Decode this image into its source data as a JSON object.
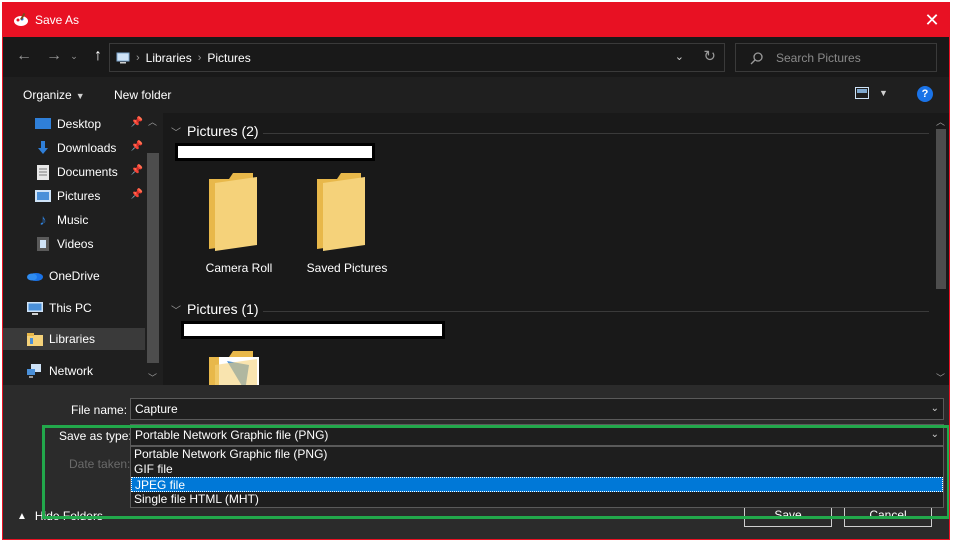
{
  "window": {
    "title": "Save As",
    "close_label": "✕"
  },
  "nav": {
    "back_icon": "arrow-left-icon",
    "forward_icon": "arrow-right-icon",
    "up_icon": "arrow-up-icon",
    "breadcrumbs": [
      "Libraries",
      "Pictures"
    ],
    "search_placeholder": "Search Pictures"
  },
  "commands": {
    "organize": "Organize",
    "new_folder": "New folder",
    "help": "?"
  },
  "sidebar": {
    "items": [
      {
        "label": "Desktop",
        "icon": "desktop-icon",
        "pinned": true
      },
      {
        "label": "Downloads",
        "icon": "download-icon",
        "pinned": true
      },
      {
        "label": "Documents",
        "icon": "document-icon",
        "pinned": true
      },
      {
        "label": "Pictures",
        "icon": "pictures-icon",
        "pinned": true
      },
      {
        "label": "Music",
        "icon": "music-icon",
        "pinned": false
      },
      {
        "label": "Videos",
        "icon": "video-icon",
        "pinned": false
      },
      {
        "label": "OneDrive",
        "icon": "cloud-icon",
        "pinned": false
      },
      {
        "label": "This PC",
        "icon": "computer-icon",
        "pinned": false
      },
      {
        "label": "Libraries",
        "icon": "library-icon",
        "pinned": false,
        "selected": true
      },
      {
        "label": "Network",
        "icon": "network-icon",
        "pinned": false
      }
    ]
  },
  "groups": [
    {
      "title": "Pictures (2)",
      "folders": [
        "Camera Roll",
        "Saved Pictures"
      ]
    },
    {
      "title": "Pictures (1)",
      "folders": [
        ""
      ]
    }
  ],
  "form": {
    "file_name_label": "File name:",
    "file_name_value": "Capture",
    "type_label": "Save as type:",
    "type_value": "Portable Network Graphic file (PNG)",
    "date_label": "Date taken:",
    "type_options": [
      "Portable Network Graphic file (PNG)",
      "GIF file",
      "JPEG file",
      "Single file HTML (MHT)"
    ],
    "selected_option": "JPEG file"
  },
  "buttons": {
    "hide_folders": "Hide Folders",
    "save": "Save",
    "cancel": "Cancel"
  },
  "colors": {
    "titlebar": "#e81123",
    "highlight_border": "#22a84b",
    "selection": "#0078d7",
    "folder": "#f5d27a"
  }
}
